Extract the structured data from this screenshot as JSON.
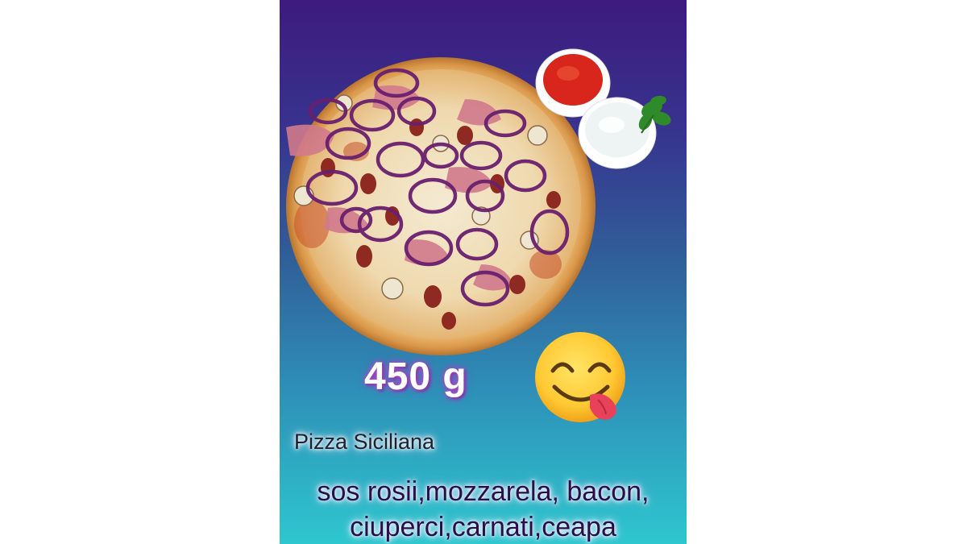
{
  "poster": {
    "weight": "450 g",
    "name": "Pizza Siciliana",
    "ingredients_line1": "sos rosii,mozzarela, bacon,",
    "ingredients_line2": "ciuperci,carnati,ceapa"
  },
  "images": {
    "main": "pizza-photo",
    "side": "sauce-bowls-photo",
    "emoji": "yum-face-emoji"
  },
  "colors": {
    "gradient_top": "#3d1a7e",
    "gradient_bottom": "#2ec7cf",
    "weight_glow": "#b04ad0"
  }
}
